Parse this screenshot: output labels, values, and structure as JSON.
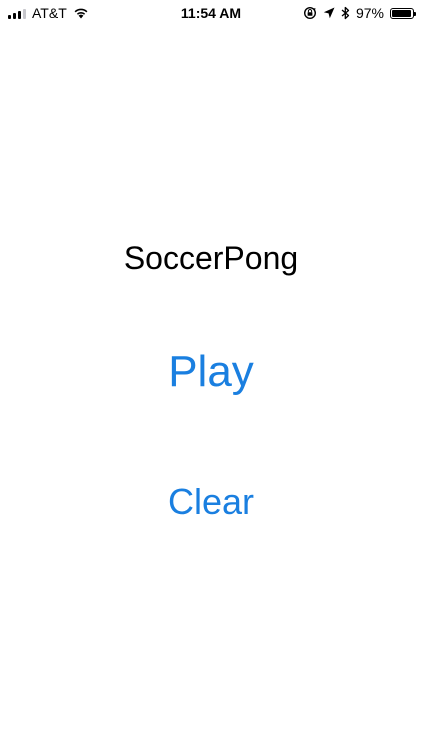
{
  "status_bar": {
    "carrier": "AT&T",
    "time": "11:54 AM",
    "battery_percent": "97%",
    "battery_level": 0.97,
    "signal_bars_filled": 3,
    "signal_bars_total": 4,
    "icons": [
      "cellular-signal-icon",
      "wifi-icon",
      "rotation-lock-icon",
      "location-arrow-icon",
      "bluetooth-icon",
      "battery-icon"
    ]
  },
  "main": {
    "title": "SoccerPong",
    "play_label": "Play",
    "clear_label": "Clear"
  },
  "colors": {
    "accent": "#1a7fe0",
    "text": "#000000",
    "background": "#ffffff"
  }
}
